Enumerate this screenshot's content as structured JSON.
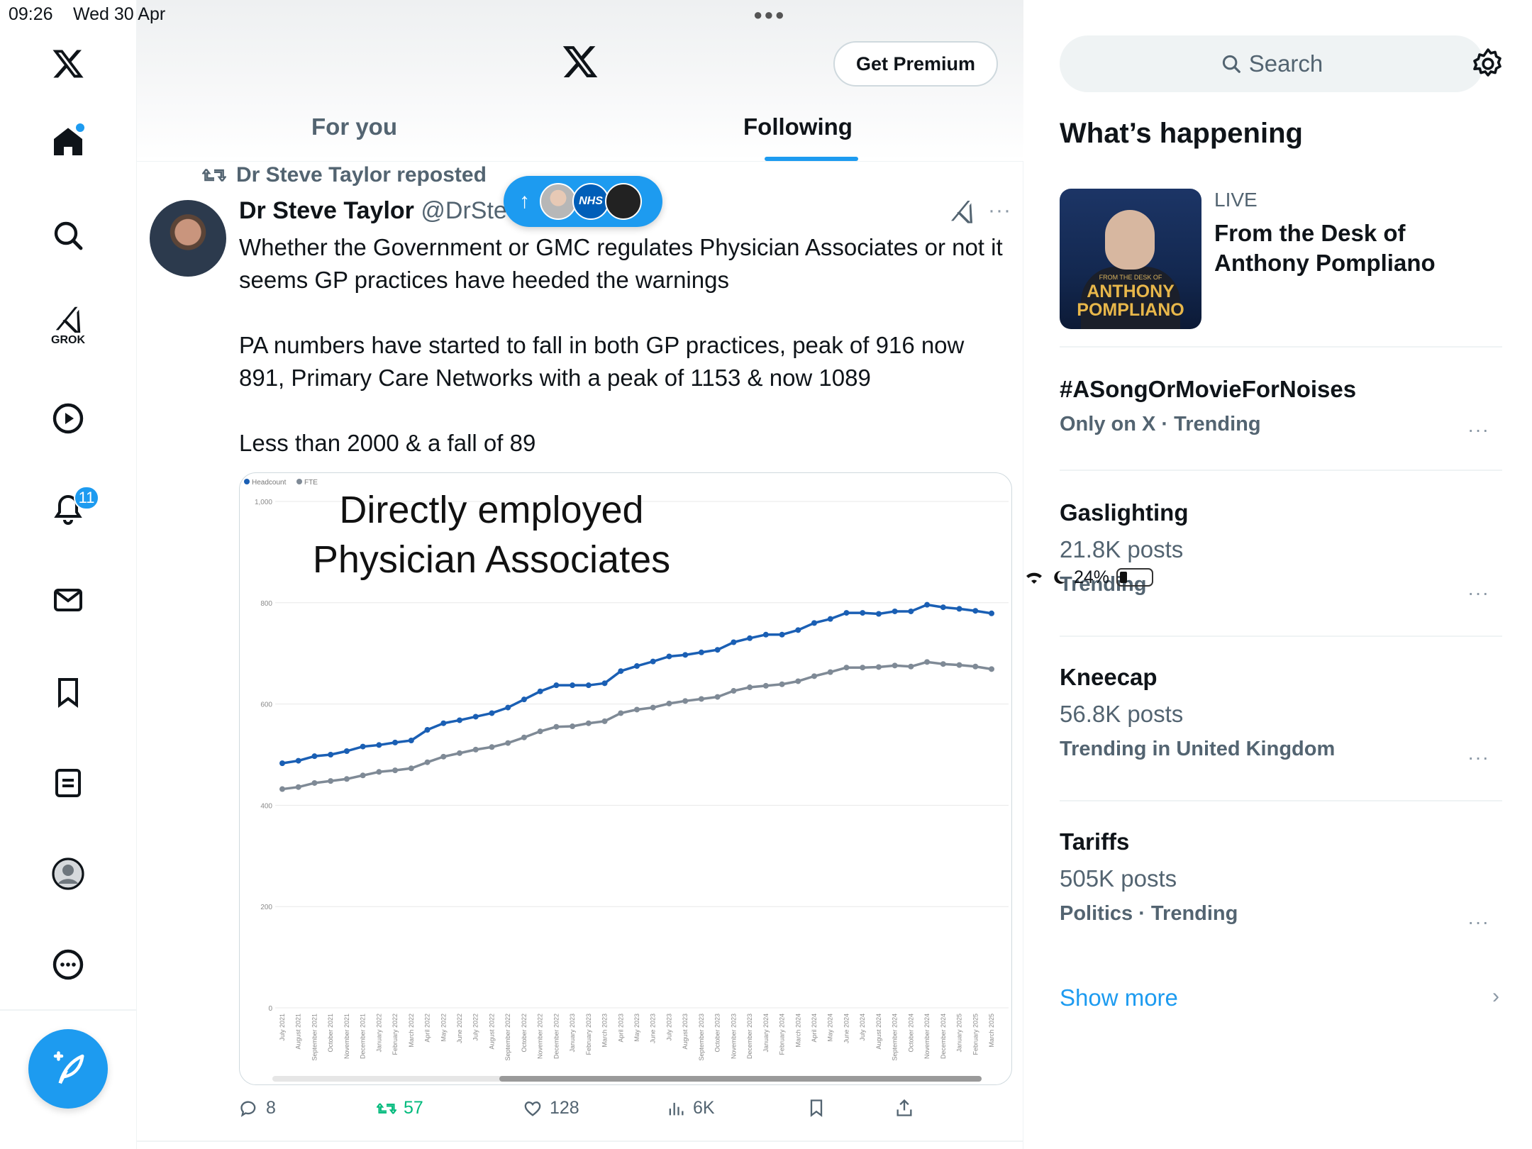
{
  "status": {
    "time": "09:26",
    "date": "Wed 30 Apr",
    "battery": "24%"
  },
  "nav": {
    "grok_label": "GROK",
    "notifications_badge": "11"
  },
  "header": {
    "premium_label": "Get Premium",
    "tabs": [
      "For you",
      "Following"
    ],
    "active_tab": "Following"
  },
  "tweet": {
    "repost_line": "Dr Steve Taylor reposted",
    "author_name": "Dr Steve Taylor",
    "author_handle": "@DrStev",
    "pill_badge": "NHS",
    "paragraphs": [
      "Whether the Government or GMC regulates Physician Associates or not it seems GP practices have heeded the warnings",
      "PA numbers have started to fall in both GP practices, peak of 916 now 891, Primary Care Networks with a peak of 1153 & now 1089",
      "Less than 2000 & a fall of 89"
    ],
    "stats": {
      "replies": "8",
      "reposts": "57",
      "likes": "128",
      "views": "6K"
    }
  },
  "chart_data": {
    "type": "line",
    "title": "Directly employed Physician Associates",
    "xlabel": "",
    "ylabel": "",
    "ylim": [
      0,
      1000
    ],
    "yticks": [
      "0",
      "200",
      "400",
      "600",
      "800",
      "1,000"
    ],
    "legend": [
      "Headcount",
      "FTE"
    ],
    "grid": true,
    "categories": [
      "July 2021",
      "August 2021",
      "September 2021",
      "October 2021",
      "November 2021",
      "December 2021",
      "January 2022",
      "February 2022",
      "March 2022",
      "April 2022",
      "May 2022",
      "June 2022",
      "July 2022",
      "August 2022",
      "September 2022",
      "October 2022",
      "November 2022",
      "December 2022",
      "January 2023",
      "February 2023",
      "March 2023",
      "April 2023",
      "May 2023",
      "June 2023",
      "July 2023",
      "August 2023",
      "September 2023",
      "October 2023",
      "November 2023",
      "December 2023",
      "January 2024",
      "February 2024",
      "March 2024",
      "April 2024",
      "May 2024",
      "June 2024",
      "July 2024",
      "August 2024",
      "September 2024",
      "October 2024",
      "November 2024",
      "December 2024",
      "January 2025",
      "February 2025",
      "March 2025"
    ],
    "series": [
      {
        "name": "Headcount",
        "color": "#1a5fb4",
        "values": [
          483,
          488,
          497,
          500,
          507,
          516,
          519,
          524,
          528,
          549,
          562,
          568,
          575,
          582,
          593,
          609,
          625,
          637,
          637,
          637,
          641,
          665,
          675,
          684,
          694,
          697,
          702,
          707,
          722,
          730,
          737,
          737,
          746,
          760,
          768,
          780,
          780,
          778,
          783,
          783,
          796,
          791,
          788,
          784,
          779
        ]
      },
      {
        "name": "FTE",
        "color": "#7f8a96",
        "values": [
          432,
          436,
          444,
          448,
          452,
          459,
          466,
          469,
          473,
          485,
          496,
          503,
          510,
          515,
          523,
          534,
          546,
          555,
          556,
          562,
          566,
          582,
          589,
          593,
          601,
          606,
          610,
          614,
          626,
          633,
          636,
          639,
          645,
          655,
          663,
          672,
          672,
          673,
          676,
          674,
          683,
          679,
          677,
          674,
          669
        ]
      }
    ]
  },
  "sidebar": {
    "search_placeholder": "Search",
    "heading": "What’s happening",
    "live": {
      "label": "LIVE",
      "title": "From the Desk of Anthony Pompliano",
      "thumb_small": "FROM THE DESK OF",
      "thumb_big1": "ANTHONY",
      "thumb_big2": "POMPLIANO"
    },
    "trends": [
      {
        "title": "#ASongOrMovieForNoises",
        "count": "",
        "meta": "Only on X · Trending"
      },
      {
        "title": "Gaslighting",
        "count": "21.8K posts",
        "meta": "Trending"
      },
      {
        "title": "Kneecap",
        "count": "56.8K posts",
        "meta": "Trending in United Kingdom"
      },
      {
        "title": "Tariffs",
        "count": "505K posts",
        "meta": "Politics · Trending"
      }
    ],
    "show_more": "Show more"
  }
}
